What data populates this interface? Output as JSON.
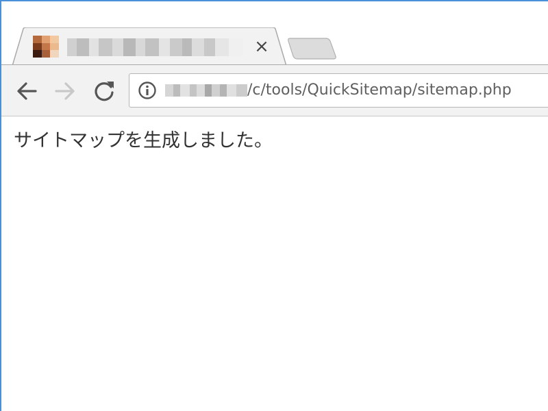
{
  "browser": {
    "tab": {
      "title": "",
      "close_glyph": "×"
    },
    "toolbar": {
      "back_icon": "back-arrow-icon",
      "forward_icon": "forward-arrow-icon",
      "reload_icon": "reload-icon"
    },
    "address_bar": {
      "info_icon": "info-icon",
      "url_path": "/c/tools/QuickSitemap/sitemap.php"
    }
  },
  "page": {
    "message": "サイトマップを生成しました。"
  },
  "colors": {
    "window_border": "#4a90d9",
    "toolbar_bg": "#f2f2f2",
    "text": "#333333",
    "url_text": "#5f5f5f"
  }
}
